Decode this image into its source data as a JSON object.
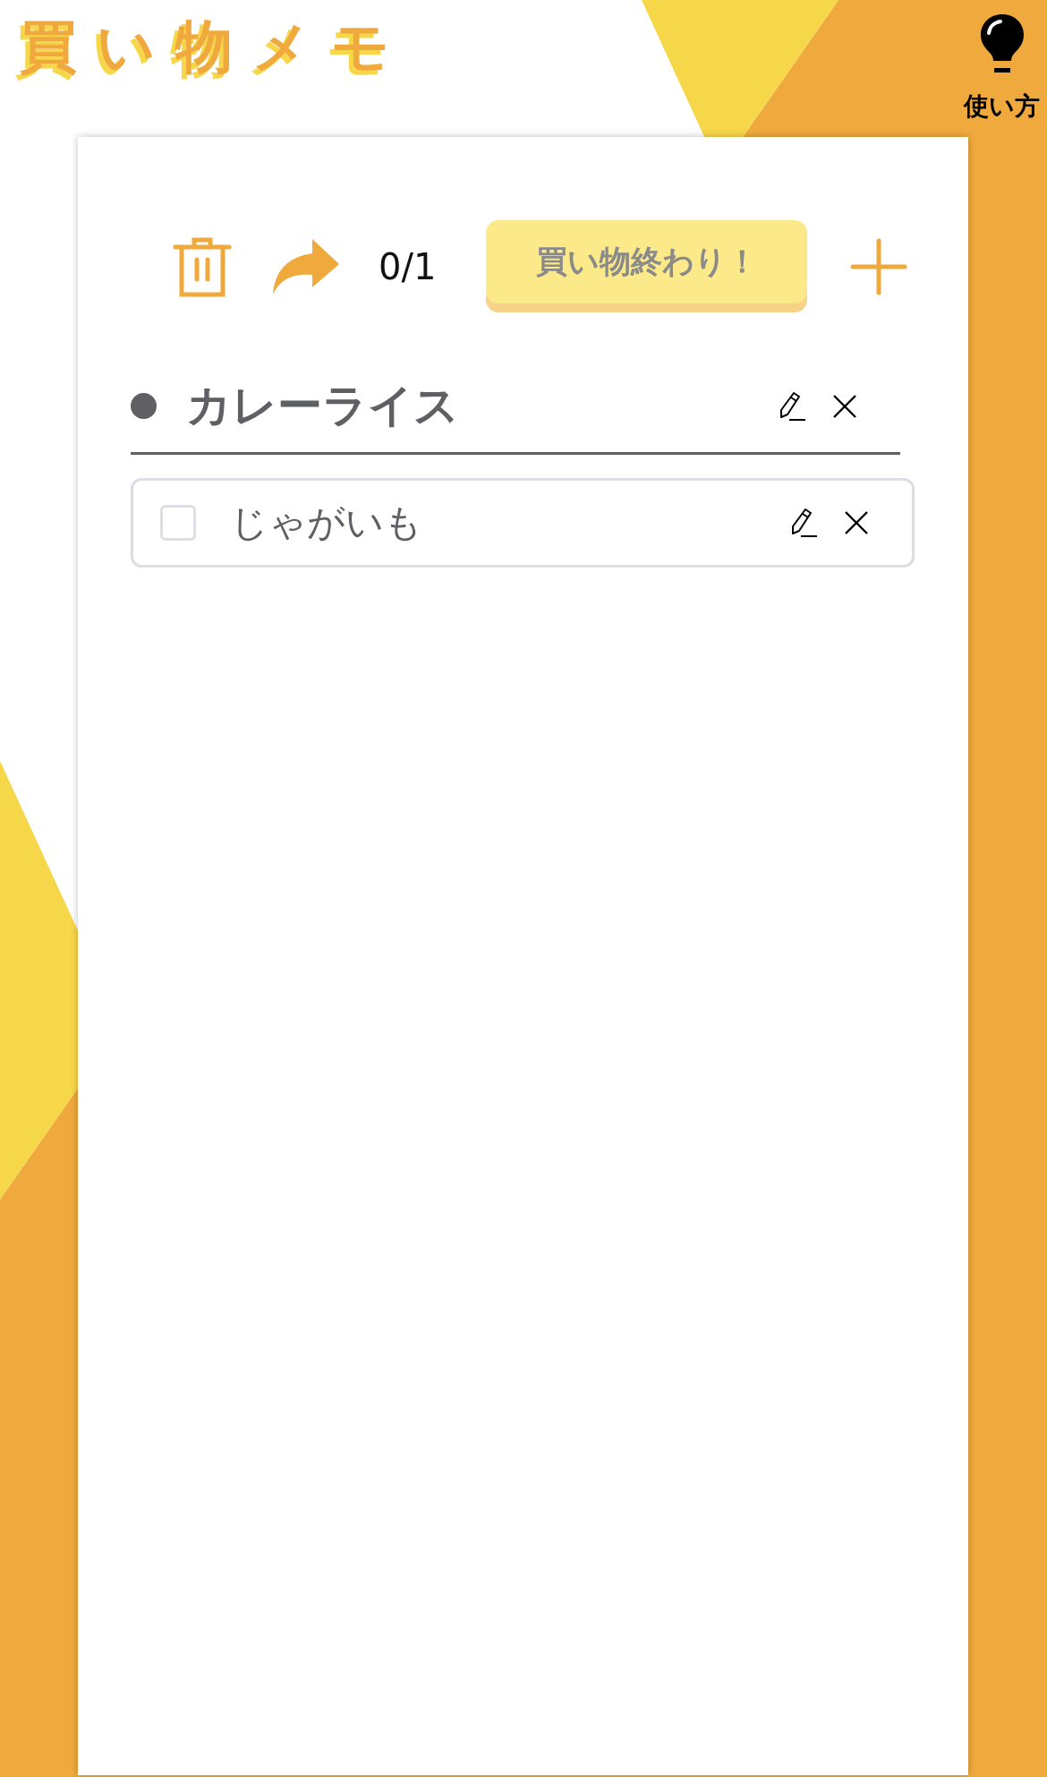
{
  "app": {
    "title": "買い物メモ",
    "help_label": "使い方"
  },
  "toolbar": {
    "progress": "0/1",
    "finish_button": "買い物終わり！"
  },
  "groups": [
    {
      "name": "カレーライス",
      "items": [
        {
          "name": "じゃがいも",
          "checked": false
        }
      ]
    }
  ]
}
